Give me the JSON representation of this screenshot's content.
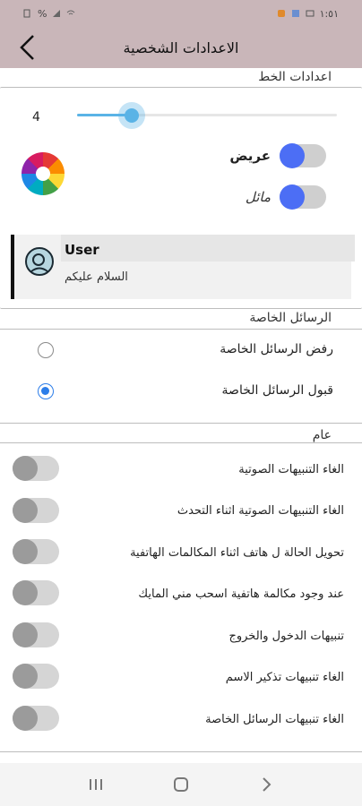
{
  "status_bar": {
    "time": "١:٥١",
    "battery": "%",
    "signal": "⁵⁄ₑ"
  },
  "header": {
    "title": "الاعدادات الشخصية"
  },
  "font_settings": {
    "title": "اعدادات الخط",
    "size": "4",
    "size_fraction": 0.21,
    "bold": {
      "label": "عريض",
      "on": true
    },
    "italic": {
      "label": "مائل",
      "on": true
    },
    "preview": {
      "name": "User",
      "message": "السلام عليكم"
    }
  },
  "private_messages": {
    "title": "الرسائل الخاصة",
    "options": [
      {
        "label": "رفض الرسائل الخاصة",
        "checked": false
      },
      {
        "label": "قبول الرسائل الخاصة",
        "checked": true
      }
    ]
  },
  "general": {
    "title": "عام",
    "items": [
      {
        "label": "الغاء التنبيهات الصوتية",
        "on": false
      },
      {
        "label": "الغاء التنبيهات الصوتية اثناء التحدث",
        "on": false
      },
      {
        "label": "تحويل الحالة ل هاتف اثناء المكالمات الهاتفية",
        "on": false
      },
      {
        "label": "عند وجود مكالمة هاتفية اسحب مني المايك",
        "on": false
      },
      {
        "label": "تنبيهات الدخول والخروج",
        "on": false
      },
      {
        "label": "الغاء تنبيهات تذكير الاسم",
        "on": false
      },
      {
        "label": "الغاء تنبيهات الرسائل الخاصة",
        "on": false
      }
    ]
  },
  "colors": {
    "header_bg": "#c9b6b9",
    "accent": "#4c6ef5",
    "slider": "#5ab3e6",
    "radio": "#2b7de9"
  },
  "icons": {
    "back": "chevron-left-icon",
    "avatar": "user-avatar-icon",
    "color_picker": "color-wheel-icon",
    "nav_recent": "recent-apps-icon",
    "nav_home": "home-icon",
    "nav_back": "back-nav-icon"
  }
}
